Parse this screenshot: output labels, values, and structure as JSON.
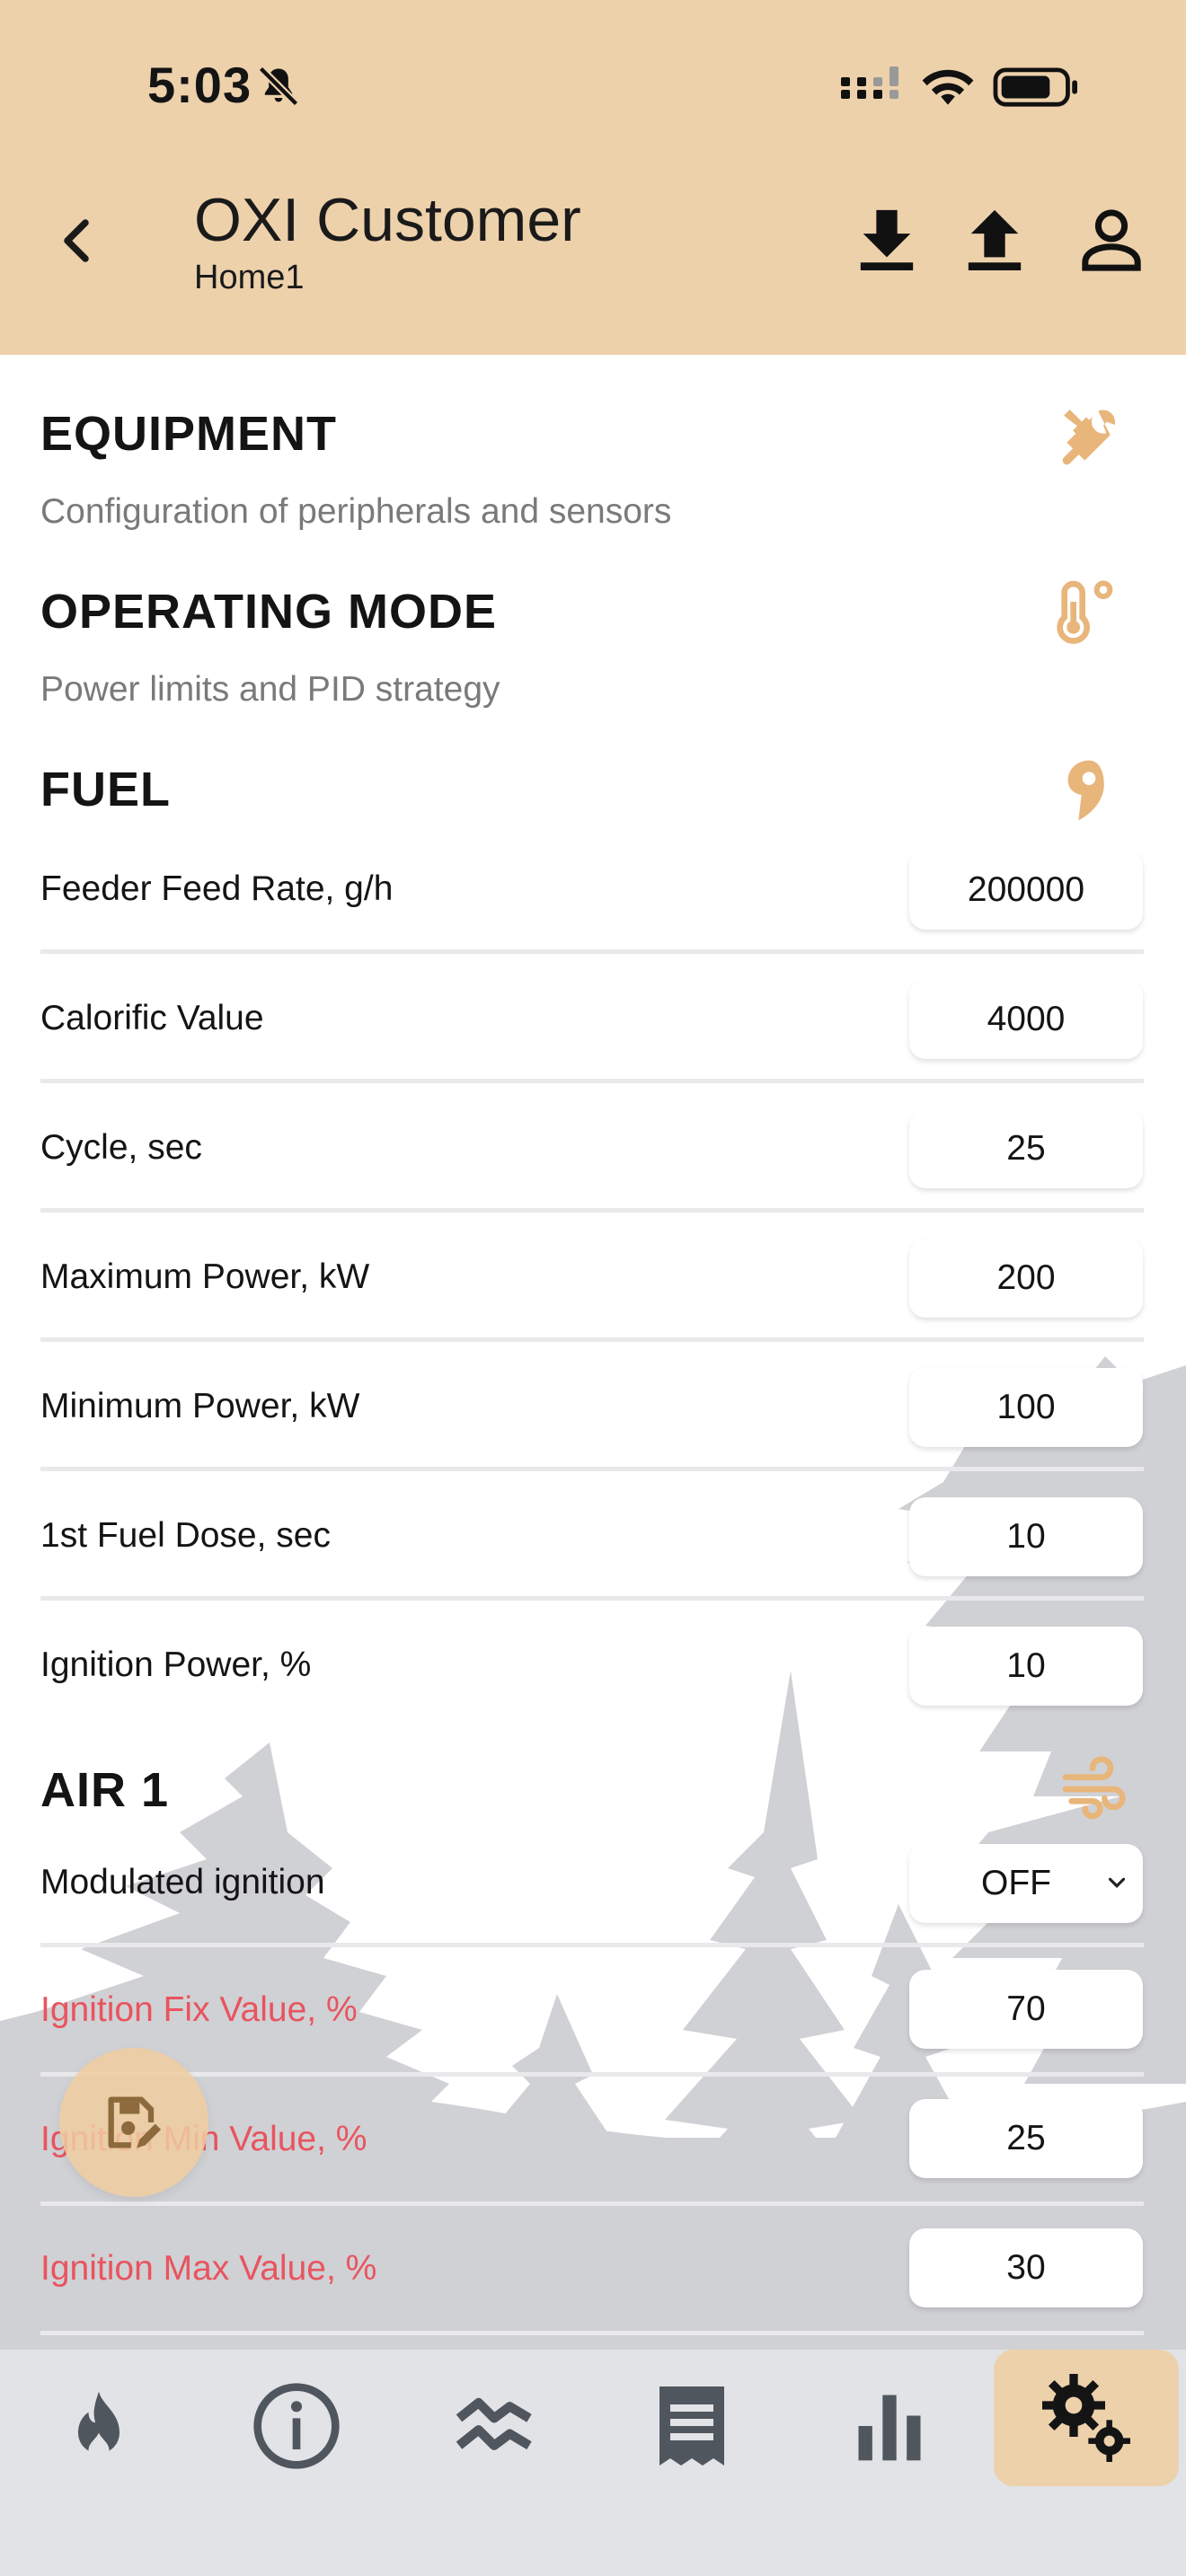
{
  "status_bar": {
    "time": "5:03"
  },
  "header": {
    "title": "OXI Customer",
    "subtitle": "Home1"
  },
  "sections": {
    "equipment": {
      "title": "EQUIPMENT",
      "description": "Configuration of peripherals and sensors"
    },
    "operating_mode": {
      "title": "OPERATING MODE",
      "description": "Power limits and PID strategy"
    },
    "fuel": {
      "title": "FUEL",
      "rows": [
        {
          "label": "Feeder Feed Rate, g/h",
          "value": "200000"
        },
        {
          "label": "Calorific Value",
          "value": "4000"
        },
        {
          "label": "Cycle, sec",
          "value": "25"
        },
        {
          "label": "Maximum Power, kW",
          "value": "200"
        },
        {
          "label": "Minimum Power, kW",
          "value": "100"
        },
        {
          "label": "1st Fuel Dose, sec",
          "value": "10"
        },
        {
          "label": "Ignition Power, %",
          "value": "10"
        }
      ]
    },
    "air1": {
      "title": "AIR 1",
      "rows": [
        {
          "label": "Modulated ignition",
          "value": "OFF"
        },
        {
          "label": "Ignition Fix Value, %",
          "value": "70"
        },
        {
          "label": "Ignition Min Value, %",
          "value": "25"
        },
        {
          "label": "Ignition Max Value, %",
          "value": "30"
        }
      ]
    }
  },
  "colors": {
    "accent": "#EDD1AB",
    "icon_accent": "#E8B57A",
    "warning_text": "#E8545F",
    "nav_bg": "#E2E3E7"
  },
  "bottom_nav": [
    "fire-icon",
    "info-icon",
    "trend-icon",
    "receipt-icon",
    "bar-chart-icon",
    "settings-icon"
  ]
}
